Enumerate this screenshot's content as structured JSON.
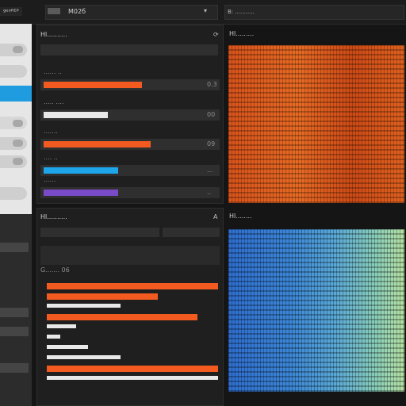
{
  "header": {
    "brand": "ᵍᵉᵒᴿᴱᴾ",
    "search_value": "M02б",
    "viewer_label": "B: ..........."
  },
  "panel_one": {
    "title": "Hl..........",
    "rows": [
      {
        "label": "...... ..",
        "value": "0.3",
        "color": "#f25a1f",
        "fill": 0.58
      },
      {
        "label": "..... ....",
        "value": "00",
        "color": "#e8e8e8",
        "fill": 0.38
      },
      {
        "label": ".......",
        "value": "09",
        "color": "#f25a1f",
        "fill": 0.63
      },
      {
        "label": ".... ..",
        "value": "...",
        "color": "#1da6ea",
        "fill": 0.44
      },
      {
        "label": "......",
        "value": "..",
        "color": "#7a4bc9",
        "fill": 0.44
      }
    ]
  },
  "panel_two": {
    "title": "Hl..........",
    "subtitle": "G....... 06",
    "bars": [
      {
        "color": "#f25a1f",
        "fill": 1.0
      },
      {
        "color": "#f25a1f",
        "fill": 0.65
      },
      {
        "color": "#e8e8e8",
        "fill": 0.43
      },
      {
        "color": "#f25a1f",
        "fill": 0.88
      },
      {
        "color": "#e8e8e8",
        "fill": 0.17
      },
      {
        "color": "#e8e8e8",
        "fill": 0.08
      },
      {
        "color": "#e8e8e8",
        "fill": 0.24
      },
      {
        "color": "#e8e8e8",
        "fill": 0.43
      },
      {
        "color": "#f25a1f",
        "fill": 1.0
      },
      {
        "color": "#e8e8e8",
        "fill": 1.0
      }
    ]
  },
  "heat_top_label": "Hl.........",
  "heat_bottom_label": "Hl........"
}
